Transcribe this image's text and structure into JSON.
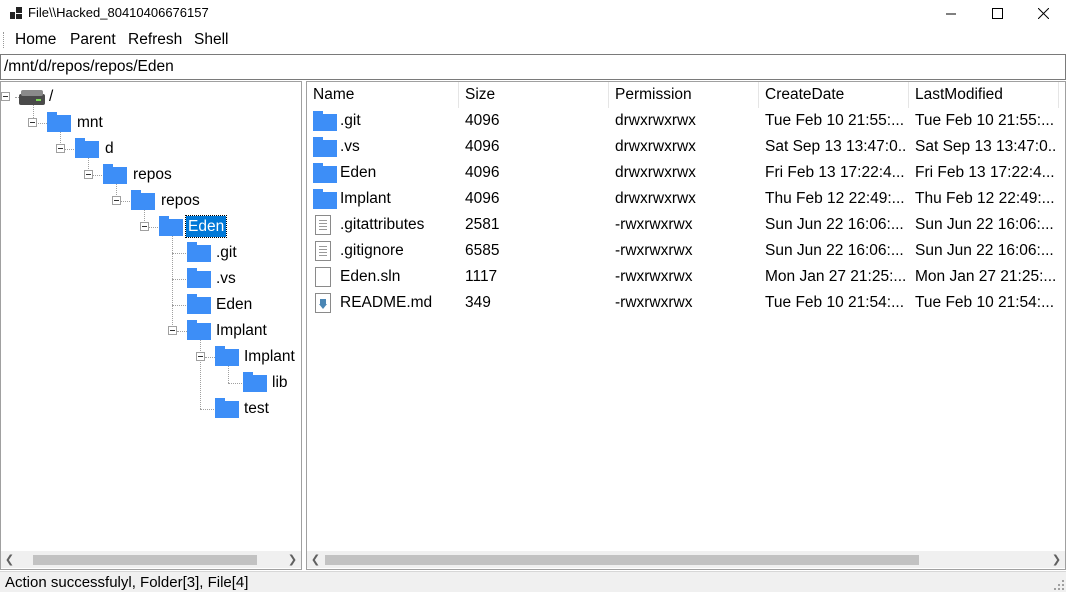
{
  "window": {
    "title": "File\\\\Hacked_80410406676157",
    "icon": "app-icon"
  },
  "menu": {
    "home": "Home",
    "parent": "Parent",
    "refresh": "Refresh",
    "shell": "Shell"
  },
  "path": {
    "value": "/mnt/d/repos/repos/Eden"
  },
  "tree": {
    "root": "/",
    "mnt": "mnt",
    "d": "d",
    "repos1": "repos",
    "repos2": "repos",
    "eden": "Eden",
    "git": ".git",
    "vs": ".vs",
    "eden_sub": "Eden",
    "implant": "Implant",
    "implant_sub": "Implant",
    "lib": "lib",
    "test": "test"
  },
  "list": {
    "columns": [
      "Name",
      "Size",
      "Permission",
      "CreateDate",
      "LastModified"
    ],
    "rows": [
      {
        "name": ".git",
        "size": "4096",
        "perm": "drwxrwxrwx",
        "created": "Tue Feb 10 21:55:...",
        "modified": "Tue Feb 10 21:55:...",
        "icon": "folder-icon"
      },
      {
        "name": ".vs",
        "size": "4096",
        "perm": "drwxrwxrwx",
        "created": "Sat Sep 13 13:47:0...",
        "modified": "Sat Sep 13 13:47:0...",
        "icon": "folder-icon"
      },
      {
        "name": "Eden",
        "size": "4096",
        "perm": "drwxrwxrwx",
        "created": "Fri Feb 13 17:22:4...",
        "modified": "Fri Feb 13 17:22:4...",
        "icon": "folder-icon"
      },
      {
        "name": "Implant",
        "size": "4096",
        "perm": "drwxrwxrwx",
        "created": "Thu Feb 12 22:49:...",
        "modified": "Thu Feb 12 22:49:...",
        "icon": "folder-icon"
      },
      {
        "name": ".gitattributes",
        "size": "2581",
        "perm": "-rwxrwxrwx",
        "created": "Sun Jun 22 16:06:...",
        "modified": "Sun Jun 22 16:06:...",
        "icon": "text-file-icon"
      },
      {
        "name": ".gitignore",
        "size": "6585",
        "perm": "-rwxrwxrwx",
        "created": "Sun Jun 22 16:06:...",
        "modified": "Sun Jun 22 16:06:...",
        "icon": "text-file-icon"
      },
      {
        "name": "Eden.sln",
        "size": "1117",
        "perm": "-rwxrwxrwx",
        "created": "Mon Jan 27 21:25:...",
        "modified": "Mon Jan 27 21:25:...",
        "icon": "blank-file-icon"
      },
      {
        "name": "README.md",
        "size": "349",
        "perm": "-rwxrwxrwx",
        "created": "Tue Feb 10 21:54:...",
        "modified": "Tue Feb 10 21:54:...",
        "icon": "markdown-file-icon"
      }
    ]
  },
  "status": {
    "text": "Action successfulyl, Folder[3], File[4]"
  },
  "colors": {
    "folder": "#3d8ef7",
    "selection": "#0078d7"
  }
}
